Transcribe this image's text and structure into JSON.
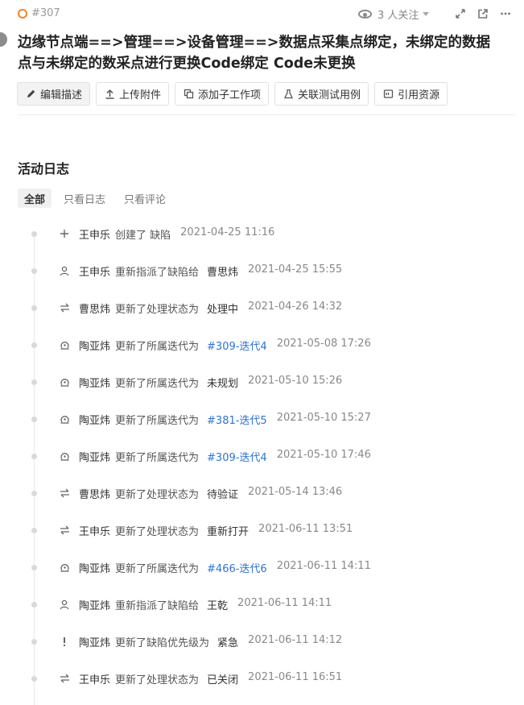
{
  "header": {
    "issue_id": "#307",
    "watchers": "3 人关注",
    "title": "边缘节点端==>管理==>设备管理==>数据点采集点绑定，未绑定的数据点与未绑定的数采点进行更换Code绑定 Code未更换"
  },
  "toolbar": {
    "edit_label": "编辑描述",
    "upload_label": "上传附件",
    "add_subtask_label": "添加子工作项",
    "link_test_label": "关联测试用例",
    "cite_label": "引用资源"
  },
  "activity": {
    "title": "活动日志",
    "filters": [
      "全部",
      "只看日志",
      "只看评论"
    ],
    "entries": [
      {
        "icon": "plus",
        "user": "王申乐",
        "action": "创建了 缺陷",
        "target": "",
        "time": "2021-04-25 11:16",
        "link": false
      },
      {
        "icon": "user",
        "user": "王申乐",
        "action": "重新指派了缺陷给",
        "target": "曹思炜",
        "time": "2021-04-25 15:55",
        "link": false
      },
      {
        "icon": "swap",
        "user": "曹思炜",
        "action": "更新了处理状态为",
        "target": "处理中",
        "time": "2021-04-26 14:32",
        "link": false
      },
      {
        "icon": "iteration",
        "user": "陶亚炜",
        "action": "更新了所属迭代为",
        "target": "#309-迭代4",
        "time": "2021-05-08 17:26",
        "link": true
      },
      {
        "icon": "iteration",
        "user": "陶亚炜",
        "action": "更新了所属迭代为",
        "target": "未规划",
        "time": "2021-05-10 15:26",
        "link": false
      },
      {
        "icon": "iteration",
        "user": "陶亚炜",
        "action": "更新了所属迭代为",
        "target": "#381-迭代5",
        "time": "2021-05-10 15:27",
        "link": true
      },
      {
        "icon": "iteration",
        "user": "陶亚炜",
        "action": "更新了所属迭代为",
        "target": "#309-迭代4",
        "time": "2021-05-10 17:46",
        "link": true
      },
      {
        "icon": "swap",
        "user": "曹思炜",
        "action": "更新了处理状态为",
        "target": "待验证",
        "time": "2021-05-14 13:46",
        "link": false
      },
      {
        "icon": "swap",
        "user": "王申乐",
        "action": "更新了处理状态为",
        "target": "重新打开",
        "time": "2021-06-11 13:51",
        "link": false
      },
      {
        "icon": "iteration",
        "user": "陶亚炜",
        "action": "更新了所属迭代为",
        "target": "#466-迭代6",
        "time": "2021-06-11 14:11",
        "link": true
      },
      {
        "icon": "user",
        "user": "陶亚炜",
        "action": "重新指派了缺陷给",
        "target": "王乾",
        "time": "2021-06-11 14:11",
        "link": false
      },
      {
        "icon": "priority",
        "user": "陶亚炜",
        "action": "更新了缺陷优先级为",
        "target": "紧急",
        "time": "2021-06-11 14:12",
        "link": false
      },
      {
        "icon": "swap",
        "user": "王申乐",
        "action": "更新了处理状态为",
        "target": "已关闭",
        "time": "2021-06-11 16:51",
        "link": false
      }
    ]
  },
  "colors": {
    "accent": "#f5832a",
    "link": "#2f73d8",
    "muted": "#888888"
  }
}
